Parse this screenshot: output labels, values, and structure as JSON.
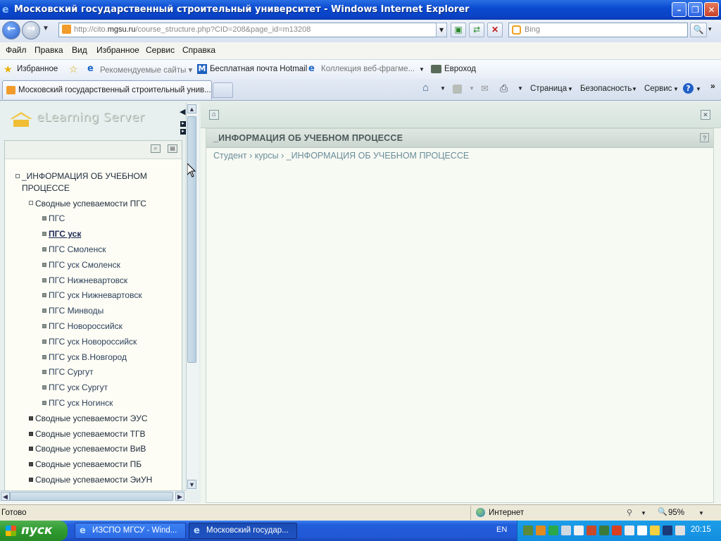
{
  "window": {
    "title": "Московский государственный строительный университет - Windows Internet Explorer"
  },
  "address": {
    "url_prefix": "http://cito.",
    "url_domain": "mgsu.ru",
    "url_rest": "/course_structure.php?CID=208&page_id=m13208"
  },
  "search": {
    "placeholder": "Bing"
  },
  "menu": [
    "Файл",
    "Правка",
    "Вид",
    "Избранное",
    "Сервис",
    "Справка"
  ],
  "favorites": {
    "label": "Избранное",
    "items": [
      "Рекомендуемые сайты ▾",
      "Бесплатная почта Hotmail",
      "Коллекция веб-фрагме...",
      "Евроход"
    ]
  },
  "tab": {
    "active_title": "Московский государственный строительный унив..."
  },
  "command_bar": {
    "page": "Страница",
    "safety": "Безопасность",
    "tools": "Сервис"
  },
  "sidebar": {
    "logo": "eLearning Server",
    "tree": {
      "root": "_ИНФОРМАЦИЯ ОБ УЧЕБНОМ",
      "root_line2": "ПРОЦЕССЕ",
      "group_open": "Сводные успеваемости ПГС",
      "children": [
        "ПГС",
        "ПГС уск",
        "ПГС Смоленск",
        "ПГС уск Смоленск",
        "ПГС Нижневартовск",
        "ПГС уск Нижневартовск",
        "ПГС Минводы",
        "ПГС Новороссийск",
        "ПГС уск Новороссийск",
        "ПГС уск В.Новгород",
        "ПГС Сургут",
        "ПГС уск Сургут",
        "ПГС уск Ногинск"
      ],
      "groups_closed": [
        "Сводные успеваемости ЭУС",
        "Сводные успеваемости ТГВ",
        "Сводные успеваемости ВиВ",
        "Сводные успеваемости ПБ",
        "Сводные успеваемости ЭиУН"
      ]
    }
  },
  "main": {
    "title": "_ИНФОРМАЦИЯ ОБ УЧЕБНОМ ПРОЦЕССЕ",
    "breadcrumb": "Студент › курсы › _ИНФОРМАЦИЯ ОБ УЧЕБНОМ ПРОЦЕССЕ",
    "help": "?"
  },
  "status": {
    "text": "Готово",
    "zone": "Интернет",
    "zoom": "95%"
  },
  "taskbar": {
    "start": "пуск",
    "tasks": [
      "ИЗСПО МГСУ - Wind...",
      "Московский государ..."
    ],
    "lang": "EN",
    "clock": "20:15"
  }
}
